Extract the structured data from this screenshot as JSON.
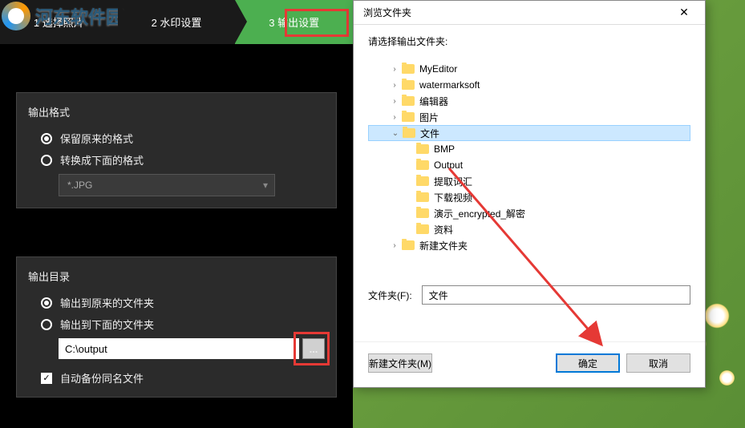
{
  "logo": {
    "text": "河东软件园"
  },
  "steps": {
    "items": [
      {
        "label": "1 选择照片"
      },
      {
        "label": "2 水印设置"
      },
      {
        "label": "3 输出设置"
      }
    ]
  },
  "format_panel": {
    "title": "输出格式",
    "keep_original": "保留原来的格式",
    "convert": "转换成下面的格式",
    "format_value": "*.JPG"
  },
  "output_panel": {
    "title": "输出目录",
    "to_original": "输出到原来的文件夹",
    "to_below": "输出到下面的文件夹",
    "path_value": "C:\\output",
    "browse_label": "...",
    "backup_label": "自动备份同名文件"
  },
  "dialog": {
    "title": "浏览文件夹",
    "close": "✕",
    "prompt": "请选择输出文件夹:",
    "tree": [
      {
        "label": "MyEditor",
        "level": 1,
        "expander": "›"
      },
      {
        "label": "watermarksoft",
        "level": 1,
        "expander": "›"
      },
      {
        "label": "编辑器",
        "level": 1,
        "expander": "›"
      },
      {
        "label": "图片",
        "level": 1,
        "expander": "›"
      },
      {
        "label": "文件",
        "level": 1,
        "expander": "⌄",
        "selected": true
      },
      {
        "label": "BMP",
        "level": 2,
        "expander": ""
      },
      {
        "label": "Output",
        "level": 2,
        "expander": ""
      },
      {
        "label": "提取词汇",
        "level": 2,
        "expander": ""
      },
      {
        "label": "下载视频",
        "level": 2,
        "expander": ""
      },
      {
        "label": "演示_encrypted_解密",
        "level": 2,
        "expander": ""
      },
      {
        "label": "资料",
        "level": 2,
        "expander": ""
      },
      {
        "label": "新建文件夹",
        "level": 1,
        "expander": "›"
      }
    ],
    "folder_label": "文件夹(F):",
    "folder_value": "文件",
    "new_folder": "新建文件夹(M)",
    "ok": "确定",
    "cancel": "取消"
  },
  "highlight_color": "#e53935"
}
